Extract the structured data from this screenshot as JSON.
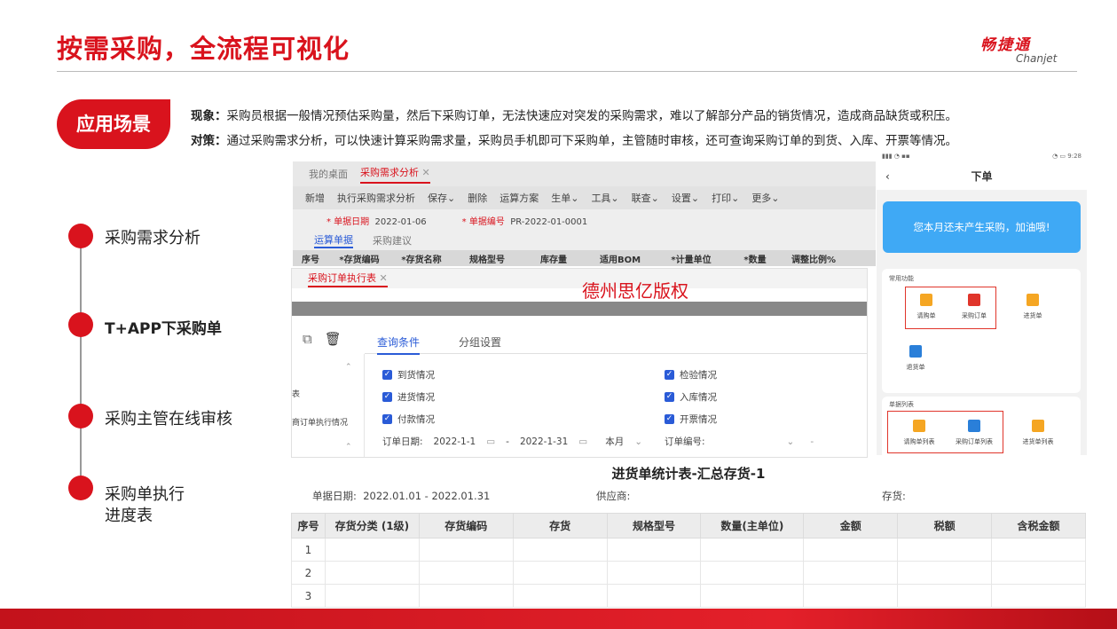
{
  "slide": {
    "title": "按需采购，全流程可视化",
    "logo_cn": "畅捷通",
    "logo_en": "Chanjet",
    "scene_label": "应用场景",
    "phenomenon_label": "现象：",
    "phenomenon_text": "采购员根据一般情况预估采购量，然后下采购订单，无法快速应对突发的采购需求，难以了解部分产品的销货情况，造成商品缺货或积压。",
    "strategy_label": "对策：",
    "strategy_text": "通过采购需求分析，可以快速计算采购需求量，采购员手机即可下采购单，主管随时审核，还可查询采购订单的到货、入库、开票等情况。"
  },
  "steps": [
    {
      "label": "采购需求分析"
    },
    {
      "label": "T+APP下采购单"
    },
    {
      "label": "采购主管在线审核"
    },
    {
      "label": "采购单执行\n进度表"
    }
  ],
  "screen1": {
    "tab_home": "我的桌面",
    "tab_active": "采购需求分析",
    "toolbar": [
      "新增",
      "执行采购需求分析",
      "保存",
      "删除",
      "运算方案",
      "生单",
      "工具",
      "联查",
      "设置",
      "打印",
      "更多"
    ],
    "date_label": "* 单据日期",
    "date_value": "2022-01-06",
    "code_label": "* 单据编号",
    "code_value": "PR-2022-01-0001",
    "subtab_active": "运算单据",
    "subtab_other": "采购建议",
    "columns": [
      "序号",
      "*存货编码",
      "*存货名称",
      "规格型号",
      "库存量",
      "适用BOM",
      "*计量单位",
      "*数量",
      "调整比例%"
    ]
  },
  "screen2": {
    "tab": "采购订单执行表",
    "watermark": "德州思亿版权",
    "query_tab": "查询条件",
    "group_tab": "分组设置",
    "left_text_1": "表",
    "left_text_2": "商订单执行情况",
    "checks": [
      "到货情况",
      "检验情况",
      "进货情况",
      "入库情况",
      "付款情况",
      "开票情况"
    ],
    "order_date_label": "订单日期:",
    "date_from": "2022-1-1",
    "date_to": "2022-1-31",
    "period": "本月",
    "order_no_label": "订单编号:"
  },
  "mobile": {
    "nav_title": "下单",
    "banner": "您本月还未产生采购，加油哦!",
    "section1": "常用功能",
    "section2": "单据列表",
    "items1": [
      "请购单",
      "采购订单",
      "进货单",
      "退货单"
    ],
    "items2": [
      "请购单列表",
      "采购订单列表",
      "进货单列表"
    ],
    "status_time": "9:28",
    "icon_colors": {
      "orange": "#f5a623",
      "red": "#e0352b",
      "blue": "#2a7fd9"
    }
  },
  "report": {
    "title": "进货单统计表-汇总存货-1",
    "date_label": "单据日期:",
    "date_range": "2022.01.01 - 2022.01.31",
    "supplier_label": "供应商:",
    "inventory_label": "存货:",
    "columns": [
      "序号",
      "存货分类 (1级)",
      "存货编码",
      "存货",
      "规格型号",
      "数量(主单位)",
      "金额",
      "税额",
      "含税金额"
    ],
    "rows": [
      "1",
      "2",
      "3"
    ]
  },
  "colors": {
    "brand_red": "#d9131d",
    "link_blue": "#2a5bd7"
  }
}
